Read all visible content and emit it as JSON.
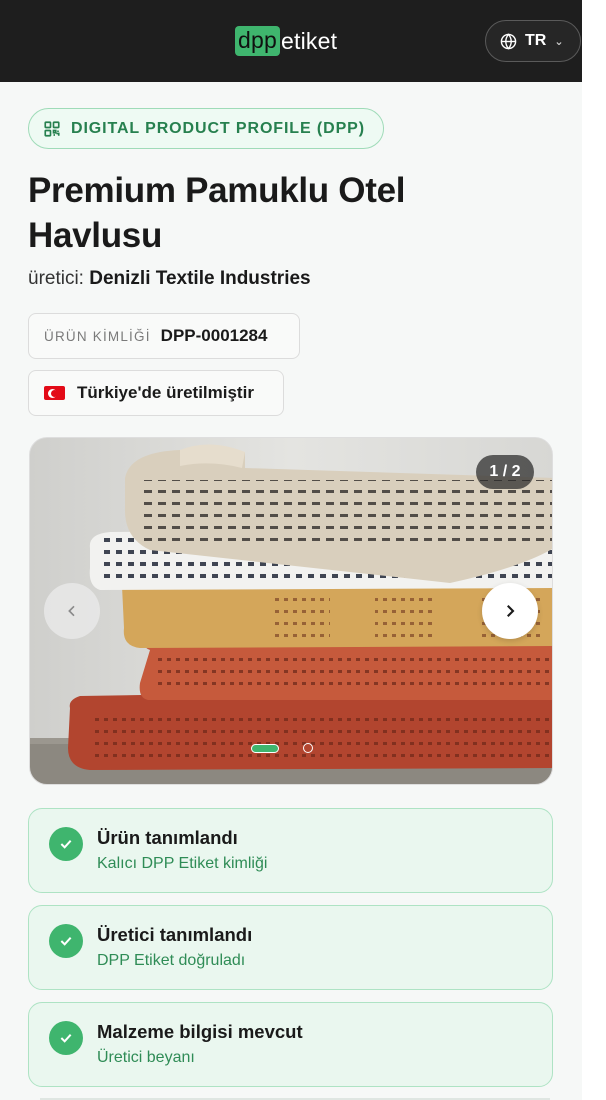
{
  "header": {
    "logo_dpp": "dpp",
    "logo_etiket": "etiket",
    "language": "TR"
  },
  "badge": {
    "label": "DIGITAL PRODUCT PROFILE (DPP)",
    "icon": "qr-code-icon"
  },
  "product": {
    "title": "Premium Pamuklu Otel Havlusu",
    "manufacturer_label": "üretici:",
    "manufacturer": "Denizli Textile Industries",
    "id_label": "ÜRÜN KİMLİĞİ",
    "id_value": "DPP-0001284",
    "origin": "Türkiye'de üretilmiştir",
    "origin_flag": "turkey-flag-icon"
  },
  "carousel": {
    "counter": "1 / 2",
    "image_alt": "stack of folded towels",
    "current_slide": 1,
    "total_slides": 2
  },
  "status_cards": [
    {
      "title": "Ürün tanımlandı",
      "subtitle": "Kalıcı DPP Etiket kimliği"
    },
    {
      "title": "Üretici tanımlandı",
      "subtitle": "DPP Etiket doğruladı"
    },
    {
      "title": "Malzeme bilgisi mevcut",
      "subtitle": "Üretici beyanı"
    }
  ],
  "colors": {
    "brand_green": "#3fb56e",
    "header_bg": "#1e1e1e",
    "card_bg": "#eaf7ef",
    "card_border": "#aee3c4",
    "subtitle_green": "#2f8c56"
  }
}
